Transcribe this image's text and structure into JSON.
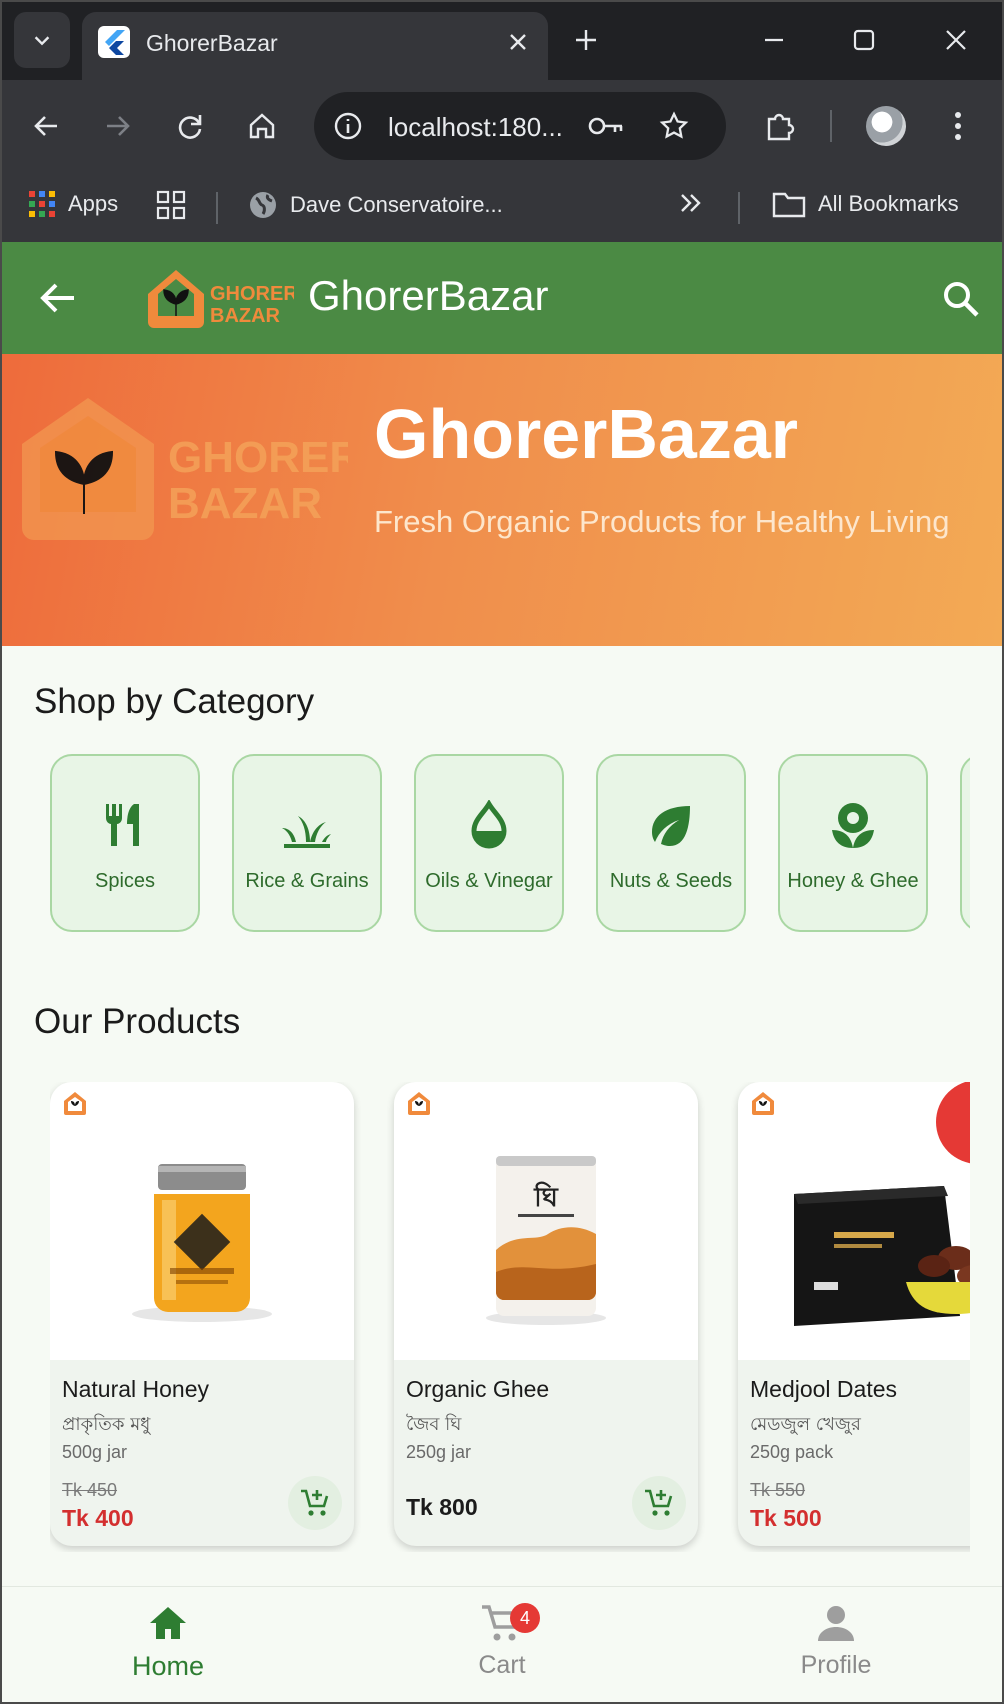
{
  "browser": {
    "tab_title": "GhorerBazar",
    "url": "localhost:180...",
    "bookmarks": {
      "apps_label": "Apps",
      "site_label": "Dave Conservatoire...",
      "all_bookmarks_label": "All Bookmarks"
    }
  },
  "app": {
    "title": "GhorerBazar",
    "logo_text_line1": "GHORER",
    "logo_text_line2": "BAZAR",
    "primary_color": "#4b8a44",
    "accent_color": "#f08a3c"
  },
  "hero": {
    "title": "GhorerBazar",
    "subtitle": "Fresh Organic Products for Healthy Living"
  },
  "categories": {
    "title": "Shop by Category",
    "items": [
      {
        "label": "Spices",
        "icon": "utensils-icon"
      },
      {
        "label": "Rice & Grains",
        "icon": "grass-icon"
      },
      {
        "label": "Oils & Vinegar",
        "icon": "drop-icon"
      },
      {
        "label": "Nuts & Seeds",
        "icon": "leaf-icon"
      },
      {
        "label": "Honey & Ghee",
        "icon": "flower-icon"
      }
    ]
  },
  "products": {
    "title": "Our Products",
    "items": [
      {
        "name": "Natural Honey",
        "name_bn": "প্রাকৃতিক মধু",
        "size": "500g jar",
        "old_price": "Tk 450",
        "price": "Tk 400"
      },
      {
        "name": "Organic Ghee",
        "name_bn": "জৈব ঘি",
        "size": "250g jar",
        "old_price": "",
        "price": "Tk 800"
      },
      {
        "name": "Medjool Dates",
        "name_bn": "মেডজুল খেজুর",
        "size": "250g pack",
        "old_price": "Tk 550",
        "price": "Tk 500"
      }
    ]
  },
  "bottom_nav": {
    "home": "Home",
    "cart": "Cart",
    "cart_count": "4",
    "profile": "Profile"
  }
}
